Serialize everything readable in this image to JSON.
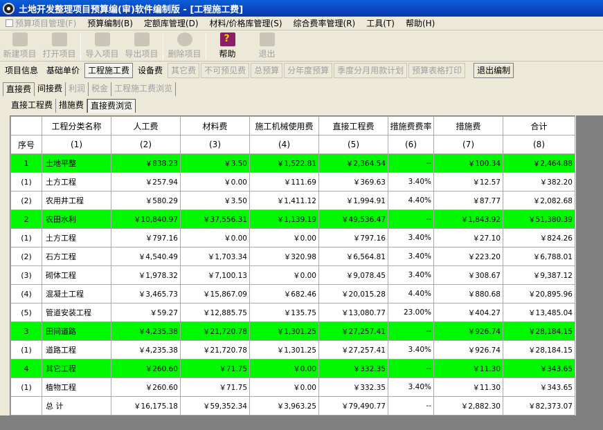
{
  "window": {
    "title": "土地开发整理项目预算编(审)软件编制版 - [工程施工费]"
  },
  "menu": [
    {
      "label": "预算项目管理(F)",
      "disabled": true,
      "icon": "document-icon"
    },
    {
      "label": "预算编制(B)",
      "disabled": false
    },
    {
      "label": "定额库管理(D)",
      "disabled": false
    },
    {
      "label": "材料/价格库管理(S)",
      "disabled": false
    },
    {
      "label": "综合费率管理(R)",
      "disabled": false
    },
    {
      "label": "工具(T)",
      "disabled": false
    },
    {
      "label": "帮助(H)",
      "disabled": false
    }
  ],
  "toolbar": {
    "new_project": "新建项目",
    "open_project": "打开项目",
    "import_project": "导入项目",
    "export_project": "导出项目",
    "delete_project": "删除项目",
    "help": "帮助",
    "exit": "退出"
  },
  "funcbar": {
    "items": [
      "项目信息",
      "基础单价",
      "工程施工费",
      "设备费",
      "其它费",
      "不可预见费",
      "总预算",
      "分年度预算",
      "季度分月用款计划",
      "预算表格打印"
    ],
    "exit_edit": "退出编制"
  },
  "tabs_level1": [
    "直接费",
    "间接费",
    "利润",
    "税金",
    "工程施工费浏览"
  ],
  "tabs_level2": [
    "直接工程费",
    "措施费",
    "直接费浏览"
  ],
  "table": {
    "headers": [
      "工程分类名称",
      "人工费",
      "材料费",
      "施工机械使用费",
      "直接工程费",
      "措施费费率",
      "措施费",
      "合计"
    ],
    "seq_header": "序号",
    "col_numbers": [
      "(1)",
      "(2)",
      "(3)",
      "(4)",
      "(5)",
      "(6)",
      "(7)",
      "(8)"
    ],
    "rows": [
      {
        "seq": "1",
        "name": "土地平整",
        "labor": "￥838.23",
        "material": "￥3.50",
        "machine": "￥1,522.81",
        "direct": "￥2,364.54",
        "rate": "--",
        "measure": "￥100.34",
        "total": "￥2,464.88",
        "highlight": true
      },
      {
        "seq": "(1)",
        "name": "土方工程",
        "labor": "￥257.94",
        "material": "￥0.00",
        "machine": "￥111.69",
        "direct": "￥369.63",
        "rate": "3.40%",
        "measure": "￥12.57",
        "total": "￥382.20",
        "highlight": false
      },
      {
        "seq": "(2)",
        "name": "农用井工程",
        "labor": "￥580.29",
        "material": "￥3.50",
        "machine": "￥1,411.12",
        "direct": "￥1,994.91",
        "rate": "4.40%",
        "measure": "￥87.77",
        "total": "￥2,082.68",
        "highlight": false
      },
      {
        "seq": "2",
        "name": "农田水利",
        "labor": "￥10,840.97",
        "material": "￥37,556.31",
        "machine": "￥1,139.19",
        "direct": "￥49,536.47",
        "rate": "--",
        "measure": "￥1,843.92",
        "total": "￥51,380.39",
        "highlight": true
      },
      {
        "seq": "(1)",
        "name": "土方工程",
        "labor": "￥797.16",
        "material": "￥0.00",
        "machine": "￥0.00",
        "direct": "￥797.16",
        "rate": "3.40%",
        "measure": "￥27.10",
        "total": "￥824.26",
        "highlight": false
      },
      {
        "seq": "(2)",
        "name": "石方工程",
        "labor": "￥4,540.49",
        "material": "￥1,703.34",
        "machine": "￥320.98",
        "direct": "￥6,564.81",
        "rate": "3.40%",
        "measure": "￥223.20",
        "total": "￥6,788.01",
        "highlight": false
      },
      {
        "seq": "(3)",
        "name": "砌体工程",
        "labor": "￥1,978.32",
        "material": "￥7,100.13",
        "machine": "￥0.00",
        "direct": "￥9,078.45",
        "rate": "3.40%",
        "measure": "￥308.67",
        "total": "￥9,387.12",
        "highlight": false
      },
      {
        "seq": "(4)",
        "name": "混凝土工程",
        "labor": "￥3,465.73",
        "material": "￥15,867.09",
        "machine": "￥682.46",
        "direct": "￥20,015.28",
        "rate": "4.40%",
        "measure": "￥880.68",
        "total": "￥20,895.96",
        "highlight": false
      },
      {
        "seq": "(5)",
        "name": "管道安装工程",
        "labor": "￥59.27",
        "material": "￥12,885.75",
        "machine": "￥135.75",
        "direct": "￥13,080.77",
        "rate": "23.00%",
        "measure": "￥404.27",
        "total": "￥13,485.04",
        "highlight": false
      },
      {
        "seq": "3",
        "name": "田间道路",
        "labor": "￥4,235.38",
        "material": "￥21,720.78",
        "machine": "￥1,301.25",
        "direct": "￥27,257.41",
        "rate": "--",
        "measure": "￥926.74",
        "total": "￥28,184.15",
        "highlight": true
      },
      {
        "seq": "(1)",
        "name": "道路工程",
        "labor": "￥4,235.38",
        "material": "￥21,720.78",
        "machine": "￥1,301.25",
        "direct": "￥27,257.41",
        "rate": "3.40%",
        "measure": "￥926.74",
        "total": "￥28,184.15",
        "highlight": false
      },
      {
        "seq": "4",
        "name": "其它工程",
        "labor": "￥260.60",
        "material": "￥71.75",
        "machine": "￥0.00",
        "direct": "￥332.35",
        "rate": "--",
        "measure": "￥11.30",
        "total": "￥343.65",
        "highlight": true
      },
      {
        "seq": "(1)",
        "name": "植物工程",
        "labor": "￥260.60",
        "material": "￥71.75",
        "machine": "￥0.00",
        "direct": "￥332.35",
        "rate": "3.40%",
        "measure": "￥11.30",
        "total": "￥343.65",
        "highlight": false
      },
      {
        "seq": "",
        "name": "总      计",
        "labor": "￥16,175.18",
        "material": "￥59,352.34",
        "machine": "￥3,963.25",
        "direct": "￥79,490.77",
        "rate": "--",
        "measure": "￥2,882.30",
        "total": "￥82,373.07",
        "highlight": false
      }
    ]
  }
}
